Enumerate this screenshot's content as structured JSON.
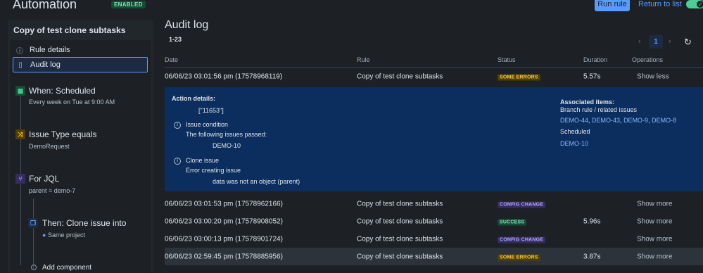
{
  "header": {
    "title": "Automation",
    "enabled_badge": "ENABLED",
    "run_rule": "Run rule",
    "return_to_list": "Return to list"
  },
  "sidebar": {
    "rule_name": "Copy of test clone subtasks",
    "nav": [
      {
        "label": "Rule details",
        "icon": "info-icon"
      },
      {
        "label": "Audit log",
        "icon": "document-icon"
      }
    ],
    "steps": [
      {
        "title": "When: Scheduled",
        "sub": "Every week on Tue at 9:00 AM",
        "icon": "calendar-icon",
        "color": "#4bce97"
      },
      {
        "title": "Issue Type equals",
        "sub": "DemoRequest",
        "icon": "shuffle-icon",
        "color": "#f5cd47"
      },
      {
        "title": "For JQL",
        "sub": "parent = demo-7",
        "icon": "branch-icon",
        "color": "#9f8fef"
      },
      {
        "title": "Then: Clone issue into",
        "sub": "Same project",
        "icon": "copy-icon",
        "color": "#579dff"
      }
    ],
    "add_component": "Add component"
  },
  "main": {
    "title": "Audit log",
    "range": "1-23",
    "page": "1",
    "columns": [
      "Date",
      "Rule",
      "Status",
      "Duration",
      "Operations"
    ]
  },
  "rows": [
    {
      "date": "06/06/23 03:01:56 pm (17578968119)",
      "rule": "Copy of test clone subtasks",
      "status": "SOME ERRORS",
      "status_type": "errors",
      "duration": "5.57s",
      "op": "Show less"
    },
    {
      "date": "06/06/23 03:01:53 pm (17578962166)",
      "rule": "Copy of test clone subtasks",
      "status": "CONFIG CHANGE",
      "status_type": "config",
      "duration": "",
      "op": "Show more"
    },
    {
      "date": "06/06/23 03:00:20 pm (17578908052)",
      "rule": "Copy of test clone subtasks",
      "status": "SUCCESS",
      "status_type": "success",
      "duration": "5.96s",
      "op": "Show more"
    },
    {
      "date": "06/06/23 03:00:13 pm (17578901724)",
      "rule": "Copy of test clone subtasks",
      "status": "CONFIG CHANGE",
      "status_type": "config",
      "duration": "",
      "op": "Show more"
    },
    {
      "date": "06/06/23 02:59:45 pm (17578885956)",
      "rule": "Copy of test clone subtasks",
      "status": "SOME ERRORS",
      "status_type": "errors",
      "duration": "3.87s",
      "op": "Show more"
    }
  ],
  "details": {
    "action_details": "Action details:",
    "action_value": "[\"11653\"]",
    "issue_condition": "Issue condition",
    "passed_text": "The following issues passed:",
    "passed_issue": "DEMO-10",
    "clone_issue": "Clone issue",
    "error_text": "Error creating issue",
    "error_detail": "data was not an object (parent)",
    "associated_title": "Associated items:",
    "branch_text": "Branch rule / related issues",
    "related": [
      "DEMO-44",
      "DEMO-43",
      "DEMO-9",
      "DEMO-8"
    ],
    "scheduled": "Scheduled",
    "scheduled_issue": "DEMO-10"
  }
}
